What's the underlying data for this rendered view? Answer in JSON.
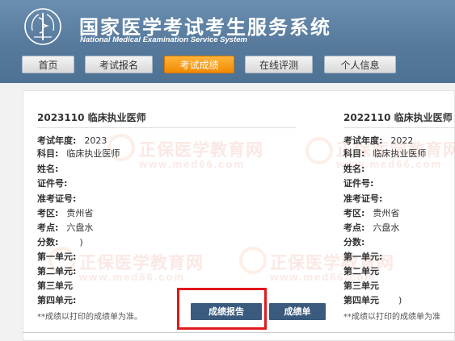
{
  "header": {
    "title": "国家医学考试考生服务系统",
    "subtitle": "National Medical Examination Service System"
  },
  "nav": [
    {
      "label": "首页"
    },
    {
      "label": "考试报名"
    },
    {
      "label": "考试成绩",
      "active": true
    },
    {
      "label": "在线评测"
    },
    {
      "label": "个人信息"
    }
  ],
  "watermark": {
    "text": "正保医学教育网",
    "url": "www.med66.com"
  },
  "cards": [
    {
      "title": "2023110  临床执业医师",
      "fields": [
        {
          "label": "考试年度:",
          "value": "2023"
        },
        {
          "label": "科目:",
          "value": "临床执业医师"
        },
        {
          "label": "姓名:",
          "value": ""
        },
        {
          "label": "证件号:",
          "value": ""
        },
        {
          "label": "准考证号:",
          "value": ""
        },
        {
          "label": "考区:",
          "value": "贵州省"
        },
        {
          "label": "考点:",
          "value": "六盘水"
        },
        {
          "label": "分数:",
          "value": ")"
        },
        {
          "label": "第一单元:",
          "value": ""
        },
        {
          "label": "第二单元:",
          "value": ""
        },
        {
          "label": "第三单元",
          "value": ""
        },
        {
          "label": "第四单元:",
          "value": ""
        }
      ],
      "note": "**成绩以打印的成绩单为准。",
      "buttons": {
        "report": "成绩报告",
        "transcript": "成绩单"
      }
    },
    {
      "title": "2022110  临床执业医师",
      "fields": [
        {
          "label": "考试年度:",
          "value": "2022"
        },
        {
          "label": "科目:",
          "value": "临床执业医师"
        },
        {
          "label": "姓名:",
          "value": ""
        },
        {
          "label": "证件号:",
          "value": ""
        },
        {
          "label": "准考证号:",
          "value": ""
        },
        {
          "label": "考区:",
          "value": "贵州省"
        },
        {
          "label": "考点:",
          "value": "六盘水"
        },
        {
          "label": "分数:",
          "value": ""
        },
        {
          "label": "第一单元:",
          "value": ""
        },
        {
          "label": "第二单元",
          "value": ""
        },
        {
          "label": "第三单元",
          "value": ""
        },
        {
          "label": "第四单元",
          "value": ")"
        }
      ],
      "note": "**成绩以打印的成绩单为准"
    }
  ],
  "colors": {
    "header": "#56799c",
    "active_tab": "#f28a00",
    "button": "#3a5a7e",
    "highlight": "#e0191b"
  }
}
